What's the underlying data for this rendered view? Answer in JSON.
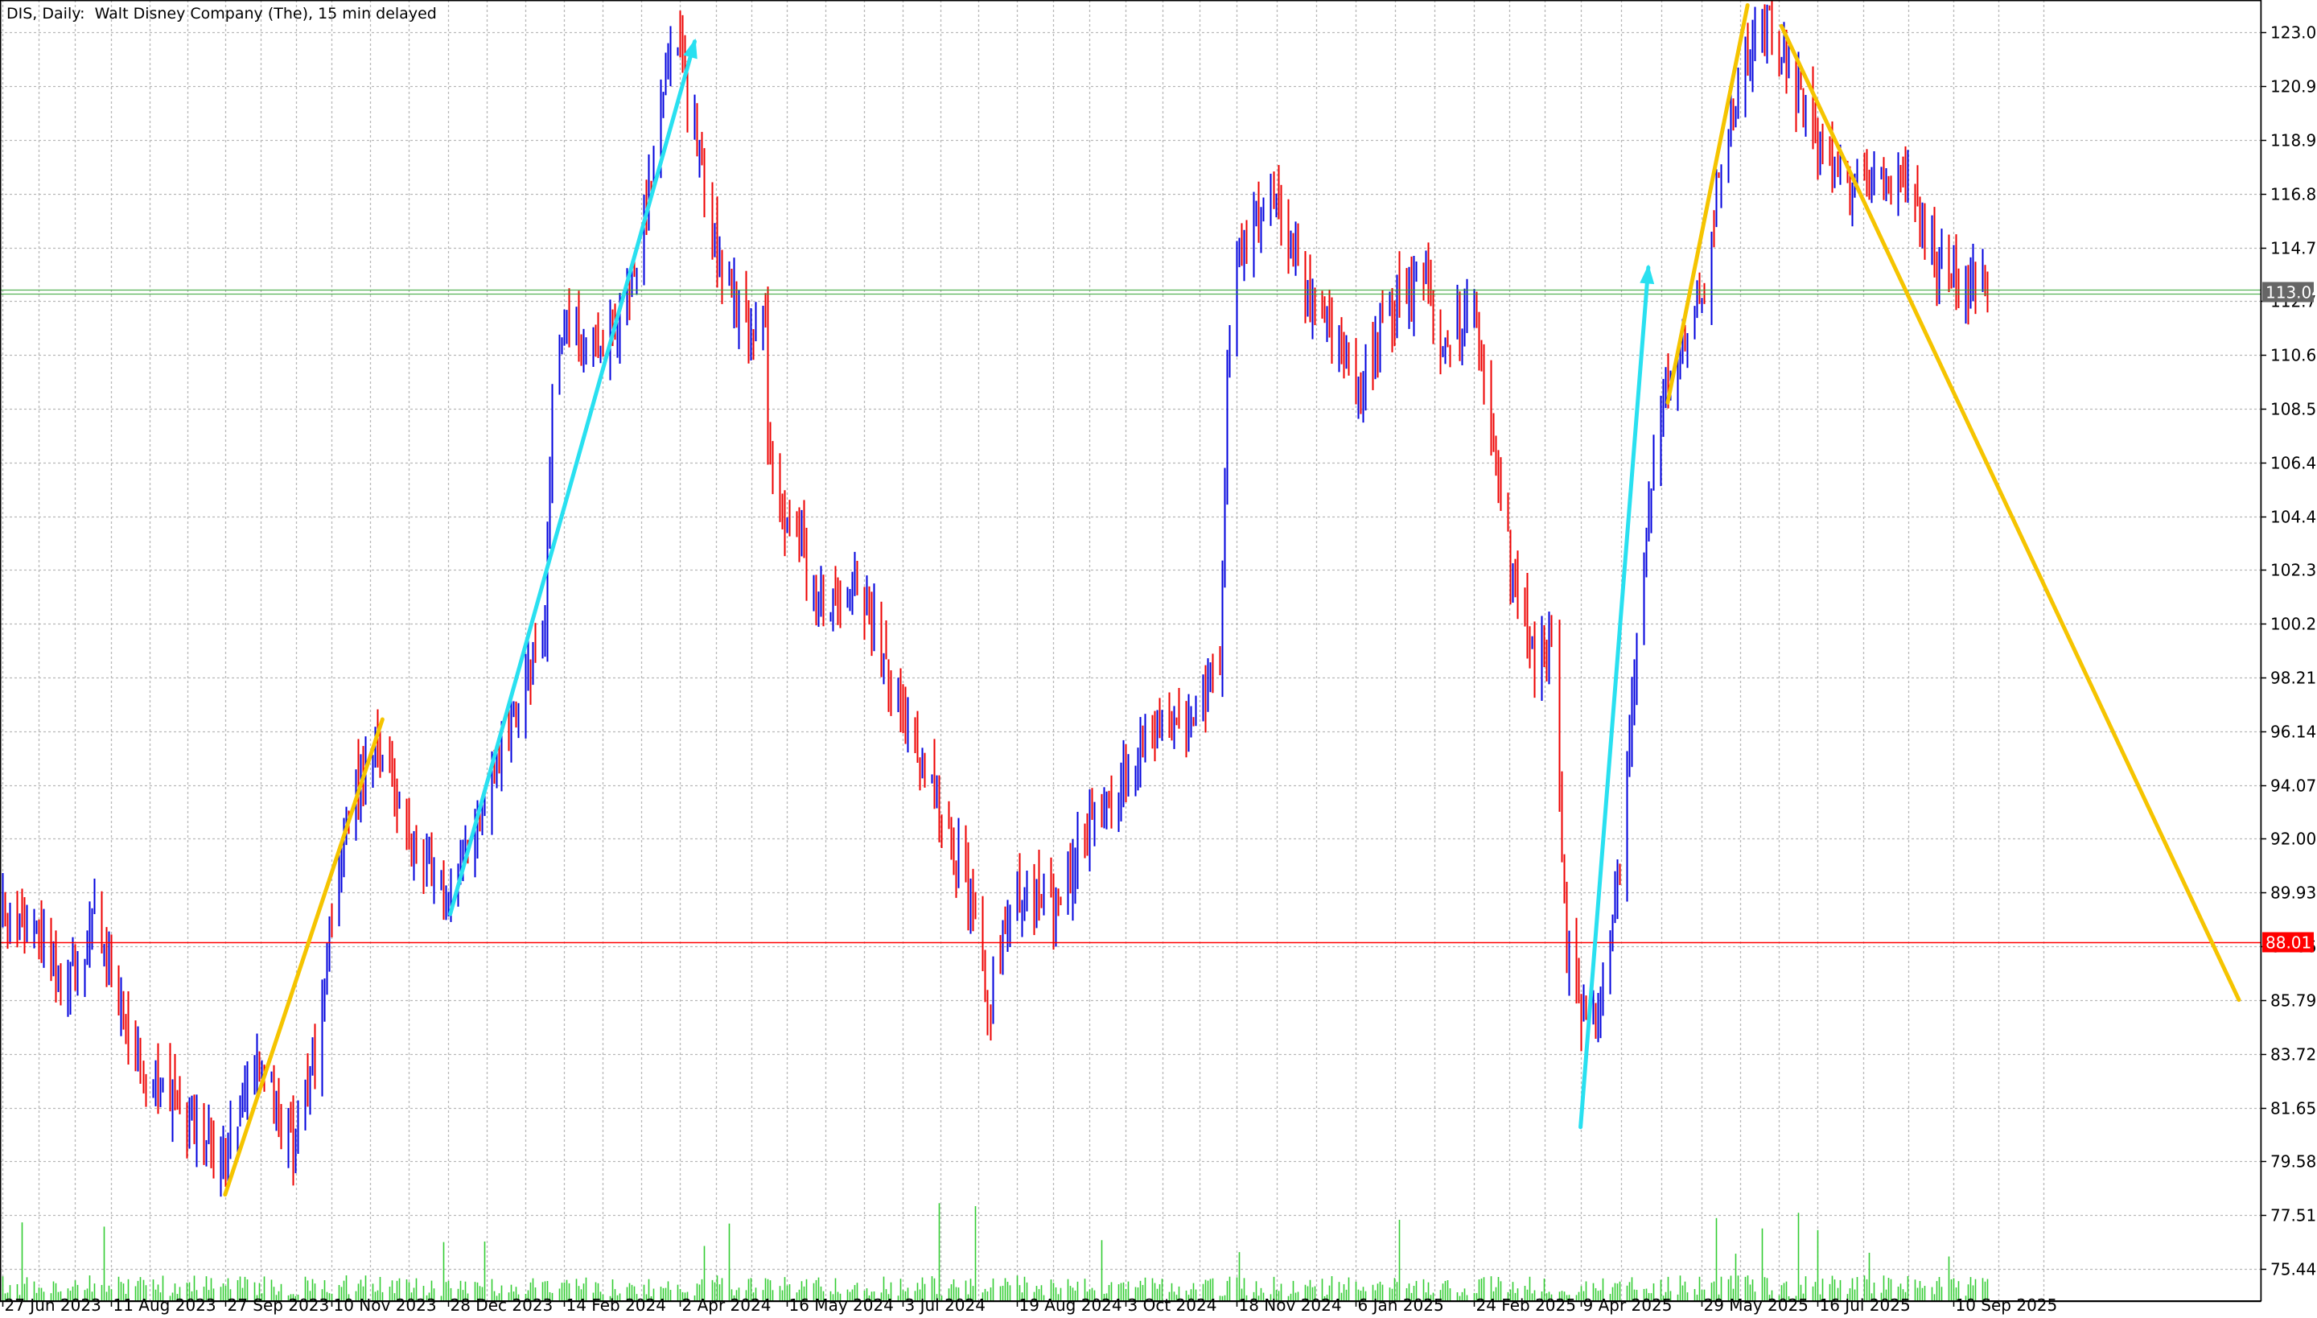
{
  "header": {
    "symbol": "DIS",
    "timeframe": "Daily:",
    "description": "Walt Disney Company (The), 15 min delayed"
  },
  "colors": {
    "background": "#ffffff",
    "grid": "#b8b8b8",
    "axis": "#000000",
    "bull_candle": "#0000dd",
    "bear_candle": "#ee0000",
    "volume": "#33cc33",
    "trend_yellow": "#f5c400",
    "trend_cyan": "#29e0f0",
    "current_price_line": "#2ca02c",
    "current_price_tag": "#666666",
    "level_line": "#ff0000",
    "level_tag": "#ff0000"
  },
  "chart_data": {
    "type": "candlestick",
    "symbol": "DIS",
    "timeframe": "Daily",
    "grid": true,
    "y_axis": {
      "side": "right",
      "range": [
        74.2,
        124.3
      ],
      "tick_labels": [
        "123.05",
        "120.98",
        "118.91",
        "116.84",
        "114.77",
        "112.70",
        "110.63",
        "108.56",
        "106.49",
        "104.42",
        "102.35",
        "100.28",
        "98.21",
        "96.14",
        "94.07",
        "92.00",
        "89.93",
        "87.86",
        "85.79",
        "83.72",
        "81.65",
        "79.58",
        "77.51",
        "75.44"
      ]
    },
    "x_axis": {
      "type": "date",
      "range": [
        "2023-06-26",
        "2026-01-15"
      ],
      "tick_labels": [
        {
          "label": "27 Jun 2023",
          "date": "2023-06-27"
        },
        {
          "label": "11 Aug 2023",
          "date": "2023-08-11"
        },
        {
          "label": "27 Sep 2023",
          "date": "2023-09-27"
        },
        {
          "label": "10 Nov 2023",
          "date": "2023-11-10"
        },
        {
          "label": "28 Dec 2023",
          "date": "2023-12-28"
        },
        {
          "label": "14 Feb 2024",
          "date": "2024-02-14"
        },
        {
          "label": "2 Apr 2024",
          "date": "2024-04-02"
        },
        {
          "label": "16 May 2024",
          "date": "2024-05-16"
        },
        {
          "label": "3 Jul 2024",
          "date": "2024-07-03"
        },
        {
          "label": "19 Aug 2024",
          "date": "2024-08-19"
        },
        {
          "label": "3 Oct 2024",
          "date": "2024-10-03"
        },
        {
          "label": "18 Nov 2024",
          "date": "2024-11-18"
        },
        {
          "label": "6 Jan 2025",
          "date": "2025-01-06"
        },
        {
          "label": "24 Feb 2025",
          "date": "2025-02-24"
        },
        {
          "label": "9 Apr 2025",
          "date": "2025-04-09"
        },
        {
          "label": "29 May 2025",
          "date": "2025-05-29"
        },
        {
          "label": "16 Jul 2025",
          "date": "2025-07-16"
        },
        {
          "label": "10 Sep 2025",
          "date": "2025-09-10"
        }
      ]
    },
    "price_path": [
      {
        "date": "2023-06-26",
        "close": 89.5
      },
      {
        "date": "2023-07-10",
        "close": 88.5
      },
      {
        "date": "2023-07-24",
        "close": 86.3
      },
      {
        "date": "2023-08-04",
        "close": 88.6
      },
      {
        "date": "2023-08-11",
        "close": 86.9
      },
      {
        "date": "2023-08-25",
        "close": 82.5
      },
      {
        "date": "2023-09-08",
        "close": 81.8
      },
      {
        "date": "2023-09-27",
        "close": 79.6
      },
      {
        "date": "2023-10-10",
        "close": 83.5
      },
      {
        "date": "2023-10-25",
        "close": 80.2
      },
      {
        "date": "2023-11-03",
        "close": 83.8
      },
      {
        "date": "2023-11-10",
        "close": 89.7
      },
      {
        "date": "2023-11-20",
        "close": 94.0
      },
      {
        "date": "2023-11-30",
        "close": 95.6
      },
      {
        "date": "2023-12-12",
        "close": 91.8
      },
      {
        "date": "2023-12-28",
        "close": 89.9
      },
      {
        "date": "2024-01-10",
        "close": 92.8
      },
      {
        "date": "2024-01-24",
        "close": 96.8
      },
      {
        "date": "2024-02-06",
        "close": 100.0
      },
      {
        "date": "2024-02-09",
        "close": 108.9
      },
      {
        "date": "2024-02-14",
        "close": 111.9
      },
      {
        "date": "2024-02-28",
        "close": 110.8
      },
      {
        "date": "2024-03-14",
        "close": 113.7
      },
      {
        "date": "2024-03-28",
        "close": 121.5
      },
      {
        "date": "2024-04-02",
        "close": 122.6
      },
      {
        "date": "2024-04-16",
        "close": 115.0
      },
      {
        "date": "2024-04-30",
        "close": 111.3
      },
      {
        "date": "2024-05-07",
        "close": 112.4
      },
      {
        "date": "2024-05-08",
        "close": 106.5
      },
      {
        "date": "2024-05-16",
        "close": 104.3
      },
      {
        "date": "2024-05-31",
        "close": 101.2
      },
      {
        "date": "2024-06-14",
        "close": 101.9
      },
      {
        "date": "2024-06-28",
        "close": 98.2
      },
      {
        "date": "2024-07-03",
        "close": 97.0
      },
      {
        "date": "2024-07-17",
        "close": 93.6
      },
      {
        "date": "2024-07-31",
        "close": 89.7
      },
      {
        "date": "2024-08-07",
        "close": 85.6
      },
      {
        "date": "2024-08-19",
        "close": 90.1
      },
      {
        "date": "2024-09-04",
        "close": 89.3
      },
      {
        "date": "2024-09-18",
        "close": 92.6
      },
      {
        "date": "2024-10-03",
        "close": 94.6
      },
      {
        "date": "2024-10-17",
        "close": 96.6
      },
      {
        "date": "2024-10-31",
        "close": 96.2
      },
      {
        "date": "2024-11-11",
        "close": 98.9
      },
      {
        "date": "2024-11-14",
        "close": 109.6
      },
      {
        "date": "2024-11-18",
        "close": 114.6
      },
      {
        "date": "2024-12-02",
        "close": 116.9
      },
      {
        "date": "2024-12-16",
        "close": 113.1
      },
      {
        "date": "2024-12-30",
        "close": 111.3
      },
      {
        "date": "2025-01-06",
        "close": 109.5
      },
      {
        "date": "2025-01-20",
        "close": 112.2
      },
      {
        "date": "2025-02-03",
        "close": 113.9
      },
      {
        "date": "2025-02-10",
        "close": 110.8
      },
      {
        "date": "2025-02-24",
        "close": 112.4
      },
      {
        "date": "2025-03-07",
        "close": 104.6
      },
      {
        "date": "2025-03-21",
        "close": 98.6
      },
      {
        "date": "2025-03-28",
        "close": 99.7
      },
      {
        "date": "2025-04-03",
        "close": 87.6
      },
      {
        "date": "2025-04-09",
        "close": 85.4
      },
      {
        "date": "2025-04-15",
        "close": 84.8
      },
      {
        "date": "2025-04-25",
        "close": 91.2
      },
      {
        "date": "2025-05-07",
        "close": 104.7
      },
      {
        "date": "2025-05-14",
        "close": 109.8
      },
      {
        "date": "2025-05-22",
        "close": 111.4
      },
      {
        "date": "2025-05-29",
        "close": 112.8
      },
      {
        "date": "2025-06-06",
        "close": 117.8
      },
      {
        "date": "2025-06-16",
        "close": 122.2
      },
      {
        "date": "2025-06-25",
        "close": 123.5
      },
      {
        "date": "2025-07-09",
        "close": 120.3
      },
      {
        "date": "2025-07-16",
        "close": 118.6
      },
      {
        "date": "2025-07-30",
        "close": 117.1
      },
      {
        "date": "2025-08-07",
        "close": 117.3
      },
      {
        "date": "2025-08-20",
        "close": 117.6
      },
      {
        "date": "2025-08-29",
        "close": 114.9
      },
      {
        "date": "2025-09-10",
        "close": 113.2
      },
      {
        "date": "2025-09-17",
        "close": 113.4
      },
      {
        "date": "2025-09-24",
        "close": 113.1
      }
    ],
    "levels": [
      {
        "price": 113.04,
        "label": "113.04",
        "kind": "current"
      },
      {
        "price": 88.01,
        "label": "88.01",
        "kind": "horizontal-line"
      }
    ],
    "trendlines": [
      {
        "color": "yellow",
        "from": {
          "date": "2023-09-27",
          "price": 78.3
        },
        "to": {
          "date": "2023-12-01",
          "price": 96.6
        },
        "arrow": false
      },
      {
        "color": "cyan",
        "from": {
          "date": "2023-12-29",
          "price": 89.1
        },
        "to": {
          "date": "2024-04-08",
          "price": 122.7
        },
        "arrow": true
      },
      {
        "color": "cyan",
        "from": {
          "date": "2025-04-09",
          "price": 80.9
        },
        "to": {
          "date": "2025-05-07",
          "price": 114.0
        },
        "arrow": true
      },
      {
        "color": "yellow",
        "from": {
          "date": "2025-05-15",
          "price": 108.8
        },
        "to": {
          "date": "2025-06-17",
          "price": 124.1
        },
        "arrow": false
      },
      {
        "color": "yellow",
        "from": {
          "date": "2025-07-01",
          "price": 123.3
        },
        "to": {
          "date": "2026-01-06",
          "price": 85.8
        },
        "arrow": false
      }
    ]
  }
}
